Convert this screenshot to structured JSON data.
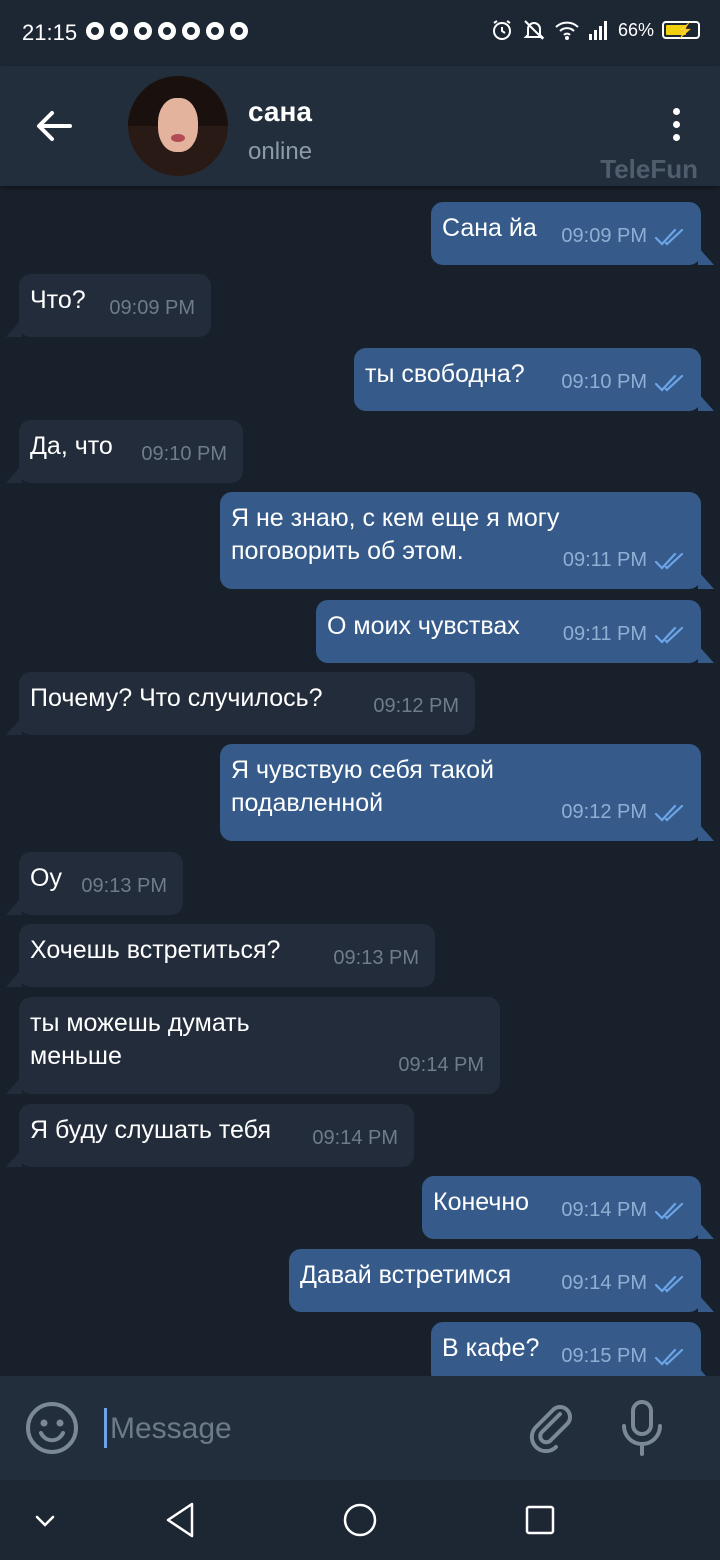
{
  "status_bar": {
    "time": "21:15",
    "battery": "66%",
    "battery_level": 0.66,
    "notification_icons": [
      "chrome-icon",
      "chrome-icon",
      "chrome-icon",
      "chrome-icon",
      "chrome-icon",
      "chrome-icon",
      "chrome-icon"
    ],
    "right_icons": [
      "alarm-icon",
      "bell-off-icon",
      "wifi-icon",
      "signal-icon",
      "battery-icon"
    ]
  },
  "header": {
    "name": "сана",
    "status": "online",
    "watermark": "TeleFun"
  },
  "messages": [
    {
      "dir": "out",
      "text": "Сана йа",
      "time": "09:09 PM",
      "read": true
    },
    {
      "dir": "in",
      "text": "Что?",
      "time": "09:09 PM"
    },
    {
      "dir": "out",
      "text": "ты свободна?",
      "time": "09:10 PM",
      "read": true
    },
    {
      "dir": "in",
      "text": "Да, что",
      "time": "09:10 PM"
    },
    {
      "dir": "out",
      "text": "Я не знаю, с кем еще я могу\nпоговорить об этом.",
      "time": "09:11 PM",
      "read": true
    },
    {
      "dir": "out",
      "text": "О моих чувствах",
      "time": "09:11 PM",
      "read": true
    },
    {
      "dir": "in",
      "text": "Почему? Что случилось?",
      "time": "09:12 PM"
    },
    {
      "dir": "out",
      "text": "Я чувствую себя такой\nподавленной",
      "time": "09:12 PM",
      "read": true
    },
    {
      "dir": "in",
      "text": "Оу",
      "time": "09:13 PM"
    },
    {
      "dir": "in",
      "text": "Хочешь встретиться?",
      "time": "09:13 PM"
    },
    {
      "dir": "in",
      "text": "ты можешь думать\nменьше",
      "time": "09:14 PM"
    },
    {
      "dir": "in",
      "text": "Я буду слушать тебя",
      "time": "09:14 PM"
    },
    {
      "dir": "out",
      "text": "Конечно",
      "time": "09:14 PM",
      "read": true
    },
    {
      "dir": "out",
      "text": "Давай встретимся",
      "time": "09:14 PM",
      "read": true
    },
    {
      "dir": "out",
      "text": "В кафе?",
      "time": "09:15 PM",
      "read": true
    }
  ],
  "composer": {
    "placeholder": "Message",
    "value": ""
  },
  "colors": {
    "background": "#18202b",
    "header": "#222e3c",
    "incoming_bubble": "#222c3a",
    "outgoing_bubble": "#365b8b",
    "read_check": "#6ba5e8"
  }
}
